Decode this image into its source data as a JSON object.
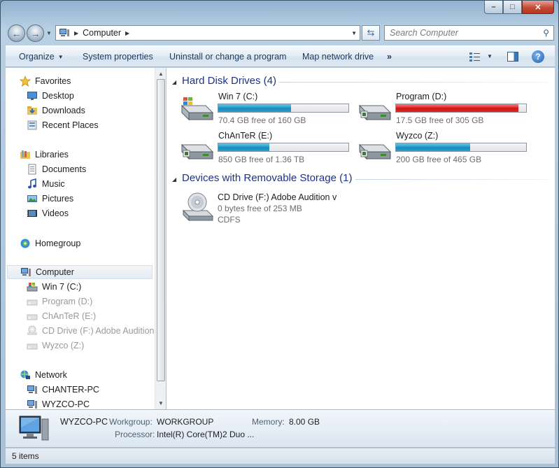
{
  "window": {
    "caption_buttons": [
      "minimize",
      "maximize",
      "close"
    ]
  },
  "address_bar": {
    "path": "Computer",
    "icon": "computer-icon"
  },
  "search": {
    "placeholder": "Search Computer"
  },
  "toolbar": {
    "organize": "Organize",
    "system_properties": "System properties",
    "uninstall": "Uninstall or change a program",
    "map_drive": "Map network drive",
    "more": "»"
  },
  "sidebar": {
    "favorites": {
      "label": "Favorites",
      "items": [
        "Desktop",
        "Downloads",
        "Recent Places"
      ]
    },
    "libraries": {
      "label": "Libraries",
      "items": [
        "Documents",
        "Music",
        "Pictures",
        "Videos"
      ]
    },
    "homegroup": "Homegroup",
    "computer": {
      "label": "Computer",
      "items": [
        "Win 7 (C:)",
        "Program (D:)",
        "ChAnTeR (E:)",
        "CD Drive (F:) Adobe Audition v",
        "Wyzco (Z:)"
      ]
    },
    "network": {
      "label": "Network",
      "items": [
        "CHANTER-PC",
        "WYZCO-PC"
      ]
    }
  },
  "main": {
    "hdd_group": "Hard Disk Drives (4)",
    "drives": [
      {
        "name": "Win 7 (C:)",
        "free_text": "70.4 GB free of 160 GB",
        "used_fraction": 0.56,
        "low_space": false,
        "system": true
      },
      {
        "name": "Program (D:)",
        "free_text": "17.5 GB free of 305 GB",
        "used_fraction": 0.94,
        "low_space": true,
        "system": false
      },
      {
        "name": "ChAnTeR (E:)",
        "free_text": "850 GB free of 1.36 TB",
        "used_fraction": 0.39,
        "low_space": false,
        "system": false
      },
      {
        "name": "Wyzco (Z:)",
        "free_text": "200 GB free of 465 GB",
        "used_fraction": 0.57,
        "low_space": false,
        "system": false
      }
    ],
    "removable_group": "Devices with Removable Storage (1)",
    "cd": {
      "name": "CD Drive (F:) Adobe Audition v",
      "free_text": "0 bytes free of 253 MB",
      "fs": "CDFS"
    }
  },
  "details": {
    "computer_name": "WYZCO-PC",
    "workgroup_label": "Workgroup:",
    "workgroup": "WORKGROUP",
    "memory_label": "Memory:",
    "memory": "8.00 GB",
    "processor_label": "Processor:",
    "processor": "Intel(R) Core(TM)2 Duo ..."
  },
  "status": {
    "items": "5 items"
  },
  "colors": {
    "bar_normal": "#27a1d1",
    "bar_low": "#e02a2a",
    "group_header": "#1e3287"
  }
}
